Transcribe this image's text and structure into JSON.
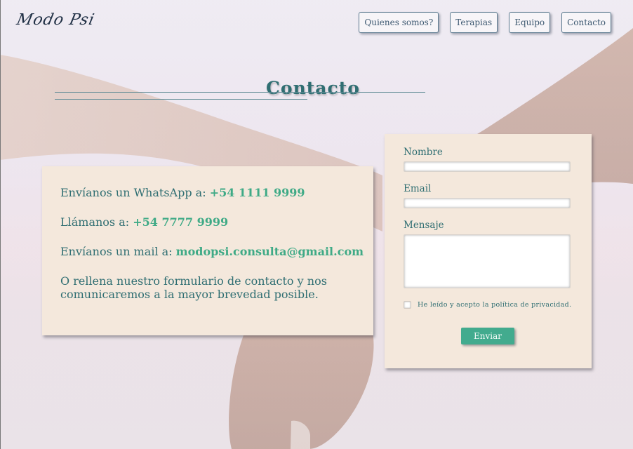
{
  "brand": {
    "logo_text": "Modo Psi"
  },
  "nav": {
    "items": [
      {
        "label": "Quienes somos?"
      },
      {
        "label": "Terapias"
      },
      {
        "label": "Equipo"
      },
      {
        "label": "Contacto"
      }
    ]
  },
  "page": {
    "title": "Contacto"
  },
  "info": {
    "whatsapp_prefix": "Envíanos un WhatsApp a: ",
    "whatsapp_number": "+54 1111 9999",
    "phone_prefix": "Llámanos a: ",
    "phone_number": "+54 7777 9999",
    "mail_prefix": "Envíanos un mail a: ",
    "mail_address": "modopsi.consulta@gmail.com",
    "closing_text": "O rellena nuestro formulario de contacto y nos comunicaremos a la mayor brevedad posible."
  },
  "form": {
    "name_label": "Nombre",
    "name_value": "",
    "email_label": "Email",
    "email_value": "",
    "message_label": "Mensaje",
    "message_value": "",
    "privacy_label": "He leído y acepto la política de privacidad.",
    "privacy_checked": false,
    "submit_label": "Enviar"
  },
  "colors": {
    "accent_green": "#42ab8e",
    "title_teal": "#2f6e72",
    "card_bg": "#f4e8dc"
  }
}
